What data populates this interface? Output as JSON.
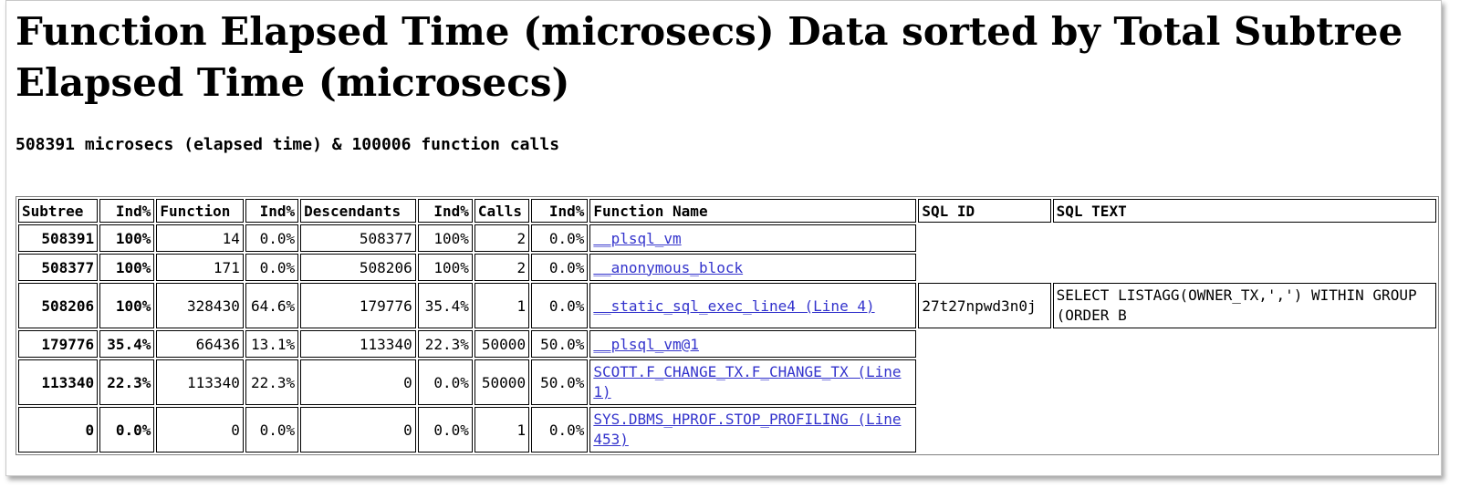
{
  "title": "Function Elapsed Time (microsecs) Data sorted by Total Subtree Elapsed Time (microsecs)",
  "summary": "508391 microsecs (elapsed time) & 100006 function calls",
  "table": {
    "headers": [
      "Subtree",
      "Ind%",
      "Function",
      "Ind%",
      "Descendants",
      "Ind%",
      "Calls",
      "Ind%",
      "Function Name",
      "SQL ID",
      "SQL TEXT"
    ],
    "rows": [
      {
        "subtree": "508391",
        "ind1": "100%",
        "function": "14",
        "ind2": "0.0%",
        "descendants": "508377",
        "ind3": "100%",
        "calls": "2",
        "ind4": "0.0%",
        "name": "__plsql_vm",
        "sql_id": "",
        "sql_text": ""
      },
      {
        "subtree": "508377",
        "ind1": "100%",
        "function": "171",
        "ind2": "0.0%",
        "descendants": "508206",
        "ind3": "100%",
        "calls": "2",
        "ind4": "0.0%",
        "name": "__anonymous_block",
        "sql_id": "",
        "sql_text": ""
      },
      {
        "subtree": "508206",
        "ind1": "100%",
        "function": "328430",
        "ind2": "64.6%",
        "descendants": "179776",
        "ind3": "35.4%",
        "calls": "1",
        "ind4": "0.0%",
        "name": "__static_sql_exec_line4 (Line 4)",
        "sql_id": "27t27npwd3n0j",
        "sql_text": "SELECT LISTAGG(OWNER_TX,',') WITHIN GROUP (ORDER B"
      },
      {
        "subtree": "179776",
        "ind1": "35.4%",
        "function": "66436",
        "ind2": "13.1%",
        "descendants": "113340",
        "ind3": "22.3%",
        "calls": "50000",
        "ind4": "50.0%",
        "name": "__plsql_vm@1",
        "sql_id": "",
        "sql_text": ""
      },
      {
        "subtree": "113340",
        "ind1": "22.3%",
        "function": "113340",
        "ind2": "22.3%",
        "descendants": "0",
        "ind3": "0.0%",
        "calls": "50000",
        "ind4": "50.0%",
        "name": "SCOTT.F_CHANGE_TX.F_CHANGE_TX (Line 1)",
        "sql_id": "",
        "sql_text": ""
      },
      {
        "subtree": "0",
        "ind1": "0.0%",
        "function": "0",
        "ind2": "0.0%",
        "descendants": "0",
        "ind3": "0.0%",
        "calls": "1",
        "ind4": "0.0%",
        "name": "SYS.DBMS_HPROF.STOP_PROFILING (Line 453)",
        "sql_id": "",
        "sql_text": ""
      }
    ]
  },
  "colors": {
    "link": "#3333cc",
    "border": "#000000",
    "frame_border": "#c8c8c8"
  }
}
